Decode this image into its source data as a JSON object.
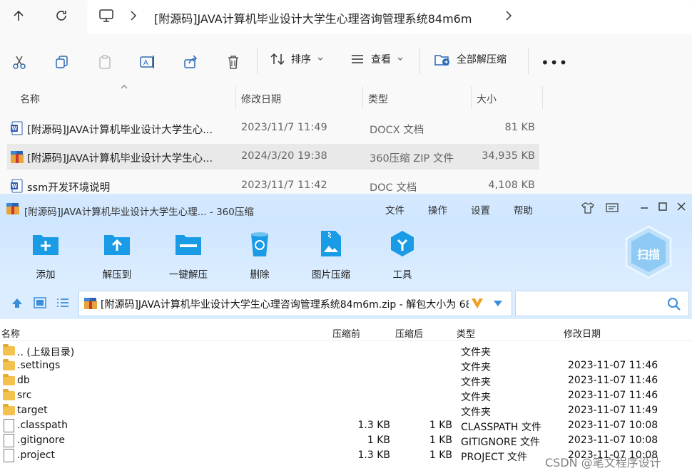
{
  "explorer": {
    "address": {
      "breadcrumb": "[附源码]JAVA计算机毕业设计大学生心理咨询管理系统84m6m"
    },
    "toolbar": {
      "sort_label": "排序",
      "view_label": "查看",
      "extract_all_label": "全部解压缩"
    },
    "columns": {
      "name": "名称",
      "modified": "修改日期",
      "type": "类型",
      "size": "大小"
    },
    "files": [
      {
        "name": "[附源码]JAVA计算机毕业设计大学生心...",
        "modified": "2023/11/7 11:49",
        "type": "DOCX 文档",
        "size": "81 KB",
        "icon": "word-doc-icon"
      },
      {
        "name": "[附源码]JAVA计算机毕业设计大学生心...",
        "modified": "2024/3/20 19:38",
        "type": "360压缩 ZIP 文件",
        "size": "34,935 KB",
        "icon": "zip-archive-icon"
      },
      {
        "name": "ssm开发环境说明",
        "modified": "2023/11/7 11:42",
        "type": "DOC 文档",
        "size": "4,108 KB",
        "icon": "word-doc-icon"
      }
    ]
  },
  "zip": {
    "title": "[附源码]JAVA计算机毕业设计大学生心理... - 360压缩",
    "menu": [
      "文件",
      "操作",
      "设置",
      "帮助"
    ],
    "tools": [
      "添加",
      "解压到",
      "一键解压",
      "删除",
      "图片压缩",
      "工具"
    ],
    "scan_label": "扫描",
    "path": "[附源码]JAVA计算机毕业设计大学生心理咨询管理系统84m6m.zip - 解包大小为 68",
    "columns": {
      "name": "名称",
      "packed": "压缩前",
      "compressed": "压缩后",
      "type": "类型",
      "modified": "修改日期"
    },
    "rows": [
      {
        "name": ".. (上级目录)",
        "packed": "",
        "compressed": "",
        "type": "文件夹",
        "modified": "",
        "kind": "folder"
      },
      {
        "name": ".settings",
        "packed": "",
        "compressed": "",
        "type": "文件夹",
        "modified": "2023-11-07 11:46",
        "kind": "folder"
      },
      {
        "name": "db",
        "packed": "",
        "compressed": "",
        "type": "文件夹",
        "modified": "2023-11-07 11:46",
        "kind": "folder"
      },
      {
        "name": "src",
        "packed": "",
        "compressed": "",
        "type": "文件夹",
        "modified": "2023-11-07 11:46",
        "kind": "folder"
      },
      {
        "name": "target",
        "packed": "",
        "compressed": "",
        "type": "文件夹",
        "modified": "2023-11-07 11:49",
        "kind": "folder"
      },
      {
        "name": ".classpath",
        "packed": "1.3 KB",
        "compressed": "1 KB",
        "type": "CLASSPATH 文件",
        "modified": "2023-11-07 10:08",
        "kind": "file"
      },
      {
        "name": ".gitignore",
        "packed": "1 KB",
        "compressed": "1 KB",
        "type": "GITIGNORE 文件",
        "modified": "2023-11-07 10:08",
        "kind": "file"
      },
      {
        "name": ".project",
        "packed": "1.3 KB",
        "compressed": "1 KB",
        "type": "PROJECT 文件",
        "modified": "2023-11-07 10:08",
        "kind": "file"
      }
    ]
  },
  "watermark": "CSDN @笔文程序设计",
  "colors": {
    "zip_header_blue": "#cfe6ff",
    "accent_blue": "#1a9be6",
    "selected_row": "#e9e9e9"
  }
}
